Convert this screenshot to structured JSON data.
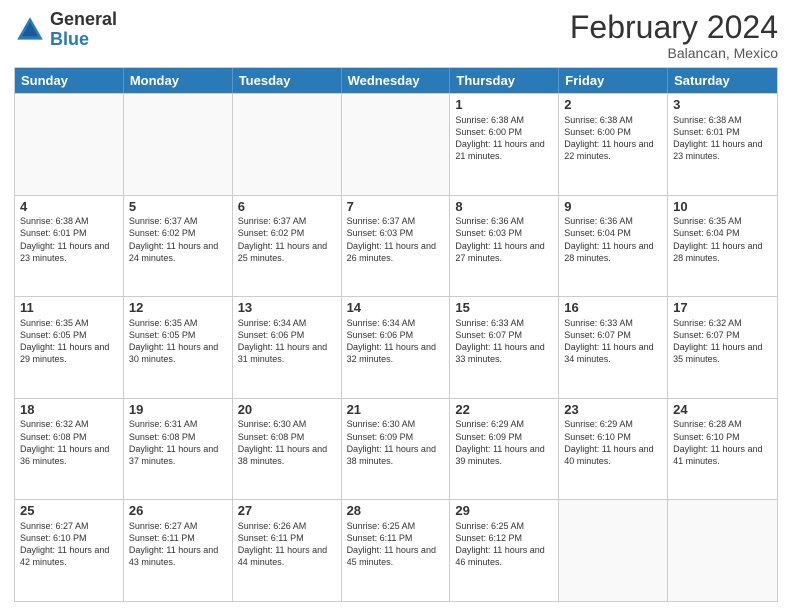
{
  "header": {
    "logo_general": "General",
    "logo_blue": "Blue",
    "title": "February 2024",
    "subtitle": "Balancan, Mexico"
  },
  "days_of_week": [
    "Sunday",
    "Monday",
    "Tuesday",
    "Wednesday",
    "Thursday",
    "Friday",
    "Saturday"
  ],
  "weeks": [
    [
      {
        "day": "",
        "empty": true
      },
      {
        "day": "",
        "empty": true
      },
      {
        "day": "",
        "empty": true
      },
      {
        "day": "",
        "empty": true
      },
      {
        "day": "1",
        "sunrise": "6:38 AM",
        "sunset": "6:00 PM",
        "daylight": "11 hours and 21 minutes."
      },
      {
        "day": "2",
        "sunrise": "6:38 AM",
        "sunset": "6:00 PM",
        "daylight": "11 hours and 22 minutes."
      },
      {
        "day": "3",
        "sunrise": "6:38 AM",
        "sunset": "6:01 PM",
        "daylight": "11 hours and 23 minutes."
      }
    ],
    [
      {
        "day": "4",
        "sunrise": "6:38 AM",
        "sunset": "6:01 PM",
        "daylight": "11 hours and 23 minutes."
      },
      {
        "day": "5",
        "sunrise": "6:37 AM",
        "sunset": "6:02 PM",
        "daylight": "11 hours and 24 minutes."
      },
      {
        "day": "6",
        "sunrise": "6:37 AM",
        "sunset": "6:02 PM",
        "daylight": "11 hours and 25 minutes."
      },
      {
        "day": "7",
        "sunrise": "6:37 AM",
        "sunset": "6:03 PM",
        "daylight": "11 hours and 26 minutes."
      },
      {
        "day": "8",
        "sunrise": "6:36 AM",
        "sunset": "6:03 PM",
        "daylight": "11 hours and 27 minutes."
      },
      {
        "day": "9",
        "sunrise": "6:36 AM",
        "sunset": "6:04 PM",
        "daylight": "11 hours and 28 minutes."
      },
      {
        "day": "10",
        "sunrise": "6:35 AM",
        "sunset": "6:04 PM",
        "daylight": "11 hours and 28 minutes."
      }
    ],
    [
      {
        "day": "11",
        "sunrise": "6:35 AM",
        "sunset": "6:05 PM",
        "daylight": "11 hours and 29 minutes."
      },
      {
        "day": "12",
        "sunrise": "6:35 AM",
        "sunset": "6:05 PM",
        "daylight": "11 hours and 30 minutes."
      },
      {
        "day": "13",
        "sunrise": "6:34 AM",
        "sunset": "6:06 PM",
        "daylight": "11 hours and 31 minutes."
      },
      {
        "day": "14",
        "sunrise": "6:34 AM",
        "sunset": "6:06 PM",
        "daylight": "11 hours and 32 minutes."
      },
      {
        "day": "15",
        "sunrise": "6:33 AM",
        "sunset": "6:07 PM",
        "daylight": "11 hours and 33 minutes."
      },
      {
        "day": "16",
        "sunrise": "6:33 AM",
        "sunset": "6:07 PM",
        "daylight": "11 hours and 34 minutes."
      },
      {
        "day": "17",
        "sunrise": "6:32 AM",
        "sunset": "6:07 PM",
        "daylight": "11 hours and 35 minutes."
      }
    ],
    [
      {
        "day": "18",
        "sunrise": "6:32 AM",
        "sunset": "6:08 PM",
        "daylight": "11 hours and 36 minutes."
      },
      {
        "day": "19",
        "sunrise": "6:31 AM",
        "sunset": "6:08 PM",
        "daylight": "11 hours and 37 minutes."
      },
      {
        "day": "20",
        "sunrise": "6:30 AM",
        "sunset": "6:08 PM",
        "daylight": "11 hours and 38 minutes."
      },
      {
        "day": "21",
        "sunrise": "6:30 AM",
        "sunset": "6:09 PM",
        "daylight": "11 hours and 38 minutes."
      },
      {
        "day": "22",
        "sunrise": "6:29 AM",
        "sunset": "6:09 PM",
        "daylight": "11 hours and 39 minutes."
      },
      {
        "day": "23",
        "sunrise": "6:29 AM",
        "sunset": "6:10 PM",
        "daylight": "11 hours and 40 minutes."
      },
      {
        "day": "24",
        "sunrise": "6:28 AM",
        "sunset": "6:10 PM",
        "daylight": "11 hours and 41 minutes."
      }
    ],
    [
      {
        "day": "25",
        "sunrise": "6:27 AM",
        "sunset": "6:10 PM",
        "daylight": "11 hours and 42 minutes."
      },
      {
        "day": "26",
        "sunrise": "6:27 AM",
        "sunset": "6:11 PM",
        "daylight": "11 hours and 43 minutes."
      },
      {
        "day": "27",
        "sunrise": "6:26 AM",
        "sunset": "6:11 PM",
        "daylight": "11 hours and 44 minutes."
      },
      {
        "day": "28",
        "sunrise": "6:25 AM",
        "sunset": "6:11 PM",
        "daylight": "11 hours and 45 minutes."
      },
      {
        "day": "29",
        "sunrise": "6:25 AM",
        "sunset": "6:12 PM",
        "daylight": "11 hours and 46 minutes."
      },
      {
        "day": "",
        "empty": true
      },
      {
        "day": "",
        "empty": true
      }
    ]
  ]
}
